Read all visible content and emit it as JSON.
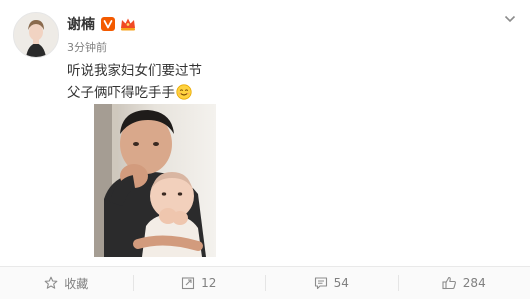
{
  "post": {
    "author": "谢楠",
    "time": "3分钟前",
    "lines": [
      "听说我家妇女们要过节",
      "父子俩吓得吃手手"
    ],
    "emoji": "smile-emoji",
    "photo_icon": "photo-father-baby"
  },
  "actions": {
    "favorite_label": "收藏",
    "repost_count": "12",
    "comment_count": "54",
    "like_count": "284"
  },
  "colors": {
    "verified_badge": "#f35a00",
    "text": "#333333",
    "meta": "#808080"
  }
}
